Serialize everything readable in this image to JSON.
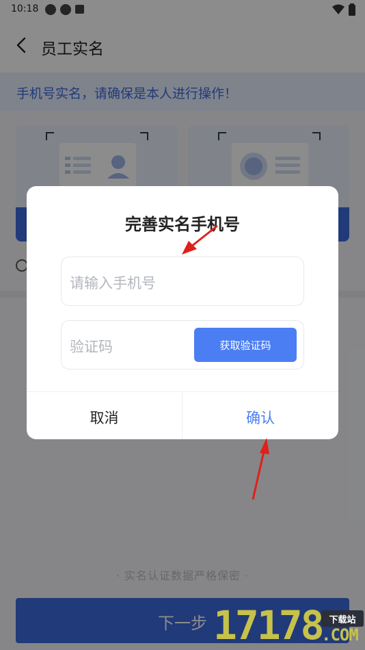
{
  "status_bar": {
    "time": "10:18"
  },
  "header": {
    "title": "员工实名"
  },
  "notice": {
    "text": "手机号实名，请确保是本人进行操作！"
  },
  "footer": {
    "note": "· 实名认证数据严格保密 ·",
    "next_label": "下一步"
  },
  "dialog": {
    "title": "完善实名手机号",
    "phone_placeholder": "请输入手机号",
    "code_placeholder": "验证码",
    "get_code_label": "获取验证码",
    "cancel_label": "取消",
    "confirm_label": "确认"
  },
  "watermark": {
    "tag": "下载站",
    "number": "17178",
    "suffix": ".COM"
  },
  "colors": {
    "accent": "#3d6bdc",
    "button": "#4c7ef3",
    "annotation": "#e0201b"
  },
  "icons": [
    "back-chevron-icon",
    "wifi-icon",
    "battery-icon",
    "info-icon",
    "id-card-front-icon",
    "id-card-back-icon"
  ]
}
